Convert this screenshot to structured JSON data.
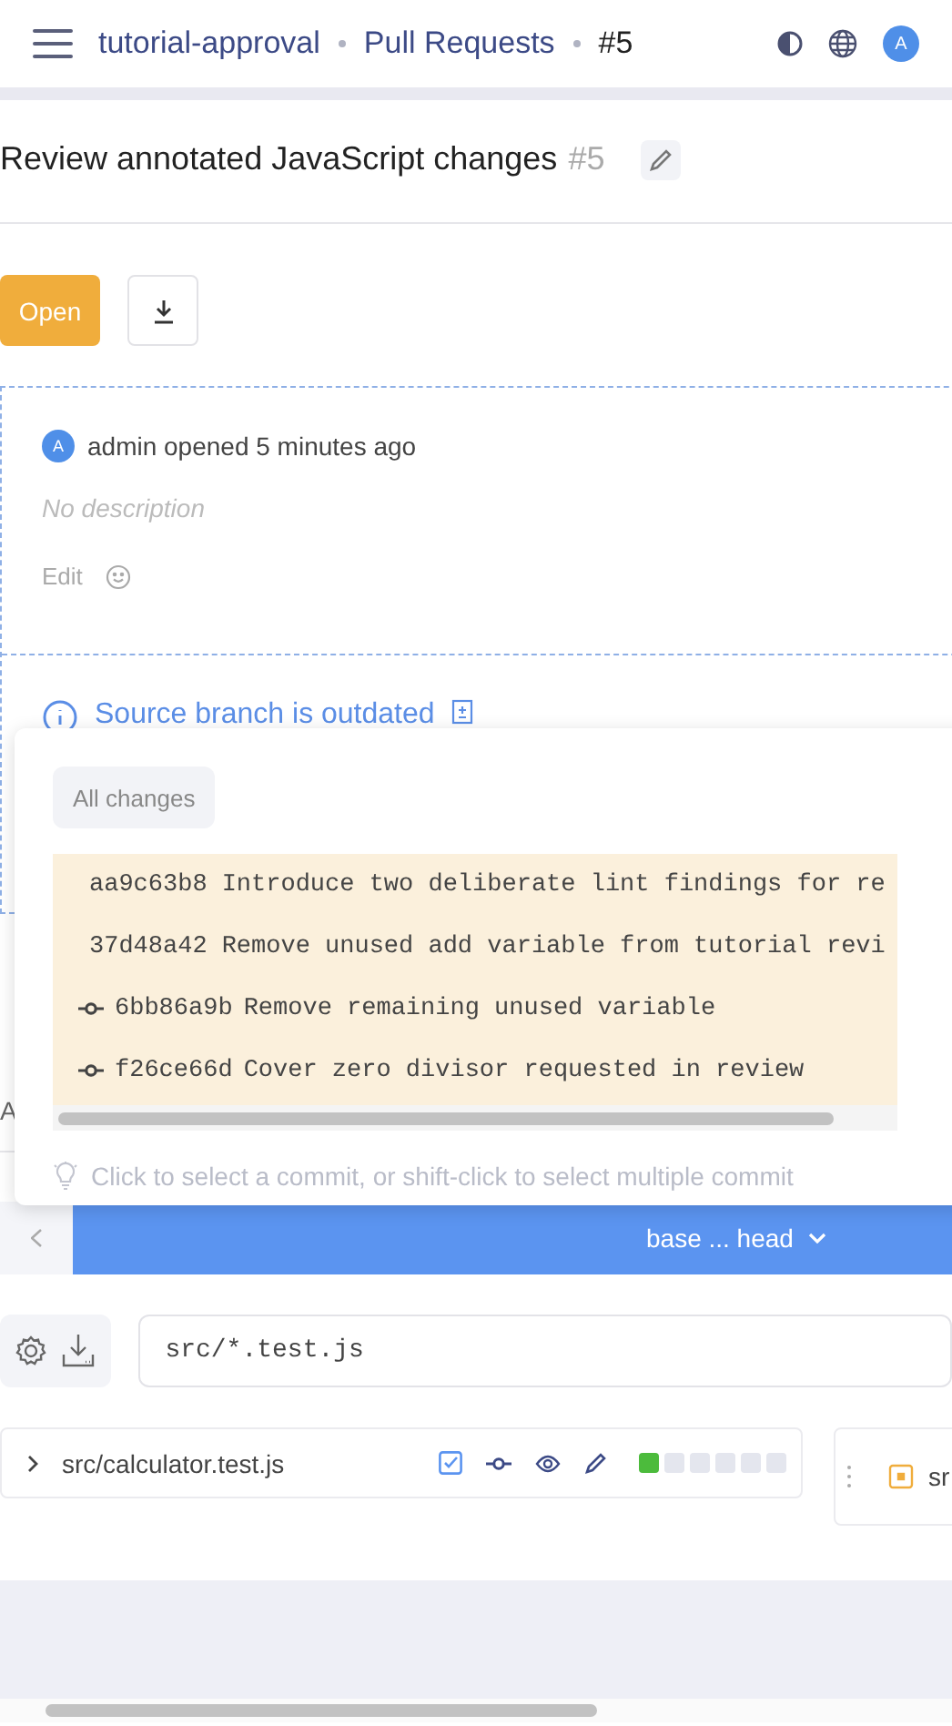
{
  "header": {
    "breadcrumbs": [
      {
        "label": "tutorial-approval",
        "kind": "link"
      },
      {
        "label": "Pull Requests",
        "kind": "link"
      },
      {
        "label": "#5",
        "kind": "current"
      }
    ],
    "avatar": "A"
  },
  "pull_request": {
    "title": "Review annotated JavaScript changes",
    "number": "#5",
    "status": "Open"
  },
  "description_card": {
    "avatar": "A",
    "author_line": "admin opened 5 minutes ago",
    "empty_text": "No description",
    "edit_label": "Edit"
  },
  "notice": {
    "text": "Source branch is outdated"
  },
  "commit_popup": {
    "filter": "All changes",
    "commits": [
      {
        "kind": "plain",
        "hash": "aa9c63b8",
        "message": "Introduce two deliberate lint findings for re"
      },
      {
        "kind": "plain",
        "hash": "37d48a42",
        "message": "Remove unused add variable from tutorial revi"
      },
      {
        "kind": "commit",
        "hash": "6bb86a9b",
        "message": "Remove remaining unused variable"
      },
      {
        "kind": "commit",
        "hash": "f26ce66d",
        "message": "Cover zero divisor requested in review"
      }
    ],
    "hint": "Click to select a commit, or shift-click to select multiple commit"
  },
  "covered_fragment": "A",
  "range_bar": {
    "label": "base ... head"
  },
  "file_filter": {
    "value": "src/*.test.js"
  },
  "files": [
    {
      "name": "src/calculator.test.js",
      "viewed": true,
      "diff_blocks": [
        {
          "color": "#4cbb3c"
        },
        {
          "color": "#e4e6ee"
        },
        {
          "color": "#e4e6ee"
        },
        {
          "color": "#e4e6ee"
        },
        {
          "color": "#e4e6ee"
        },
        {
          "color": "#e4e6ee"
        }
      ]
    }
  ],
  "side_panel": {
    "label": "sr"
  }
}
